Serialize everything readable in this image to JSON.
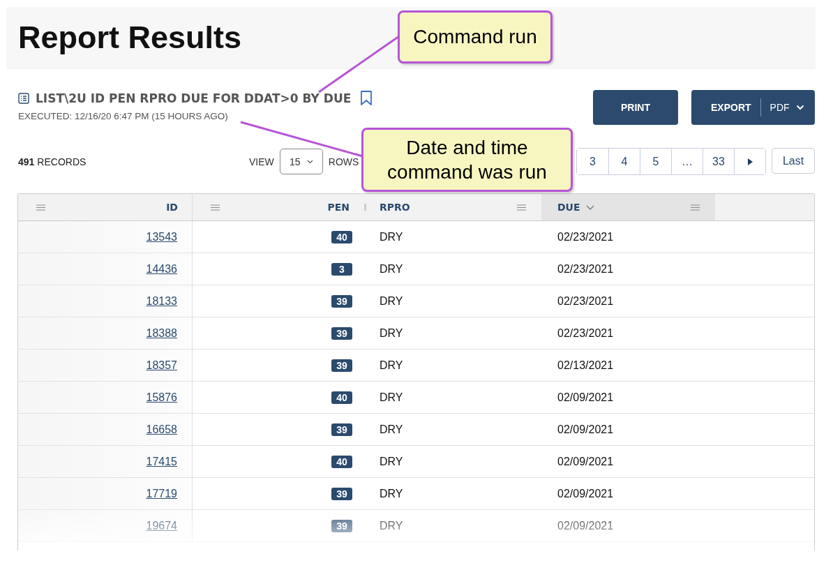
{
  "page_title": "Report Results",
  "command": {
    "text": "LIST\\2U ID PEN RPRO DUE FOR DDAT>0 BY DUE",
    "bookmarked": false
  },
  "executed": "EXECUTED: 12/16/20 6:47 PM (15 HOURS AGO)",
  "buttons": {
    "print": "PRINT",
    "export": "EXPORT",
    "format": "PDF"
  },
  "records": {
    "count": "491",
    "label": "RECORDS"
  },
  "view": {
    "label": "VIEW",
    "value": "15",
    "rows_label": "ROWS"
  },
  "pagination": {
    "pages": [
      "3",
      "4",
      "5",
      "…",
      "33"
    ],
    "last": "Last"
  },
  "table": {
    "columns": [
      {
        "label": "ID",
        "sorted": false
      },
      {
        "label": "PEN",
        "sorted": false
      },
      {
        "label": "RPRO",
        "sorted": false
      },
      {
        "label": "DUE",
        "sorted": true
      }
    ],
    "rows": [
      {
        "id": "13543",
        "pen": "40",
        "rpro": "DRY",
        "due": "02/23/2021"
      },
      {
        "id": "14436",
        "pen": "3",
        "rpro": "DRY",
        "due": "02/23/2021"
      },
      {
        "id": "18133",
        "pen": "39",
        "rpro": "DRY",
        "due": "02/23/2021"
      },
      {
        "id": "18388",
        "pen": "39",
        "rpro": "DRY",
        "due": "02/23/2021"
      },
      {
        "id": "18357",
        "pen": "39",
        "rpro": "DRY",
        "due": "02/13/2021"
      },
      {
        "id": "15876",
        "pen": "40",
        "rpro": "DRY",
        "due": "02/09/2021"
      },
      {
        "id": "16658",
        "pen": "39",
        "rpro": "DRY",
        "due": "02/09/2021"
      },
      {
        "id": "17415",
        "pen": "40",
        "rpro": "DRY",
        "due": "02/09/2021"
      },
      {
        "id": "17719",
        "pen": "39",
        "rpro": "DRY",
        "due": "02/09/2021"
      },
      {
        "id": "19674",
        "pen": "39",
        "rpro": "DRY",
        "due": "02/09/2021"
      }
    ]
  },
  "callouts": [
    {
      "text": "Command run"
    },
    {
      "text": "Date and time command was run"
    }
  ]
}
